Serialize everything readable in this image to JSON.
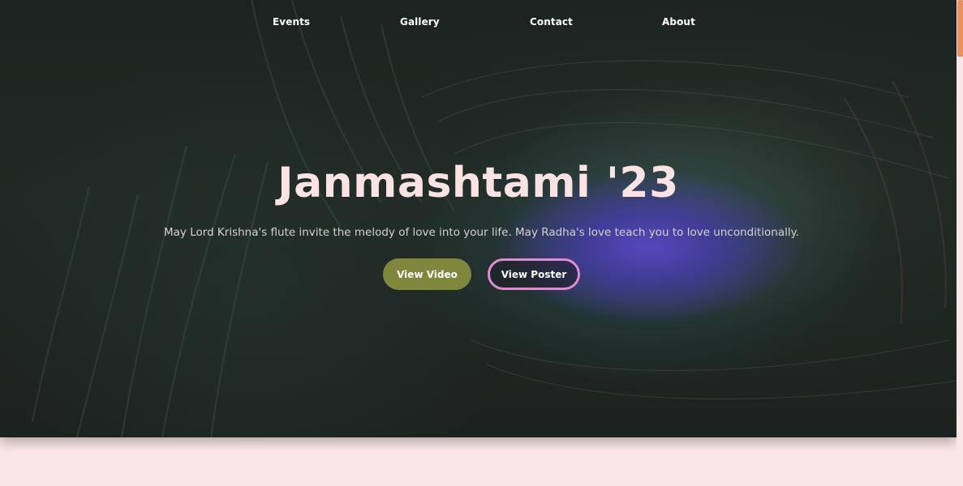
{
  "nav": {
    "items": [
      {
        "label": "Events"
      },
      {
        "label": "Gallery"
      },
      {
        "label": "Contact"
      },
      {
        "label": "About"
      }
    ]
  },
  "hero": {
    "title": "Janmashtami '23",
    "subtitle": "May Lord Krishna's flute invite the melody of love into your life. May Radha's love teach you to love unconditionally.",
    "primary_button": "View Video",
    "secondary_button": "View Poster",
    "background_image": "peacock-feather"
  },
  "colors": {
    "page_background": "#fbe6e7",
    "title": "#fbe3e3",
    "primary_button": "#7f873b",
    "secondary_button_border": "#e08ad2",
    "scrollbar_thumb": "#e9915e"
  }
}
